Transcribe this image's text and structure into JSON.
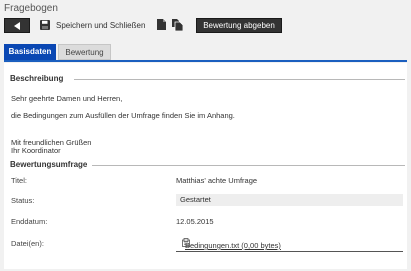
{
  "window": {
    "title": "Fragebogen"
  },
  "toolbar": {
    "back_icon": "arrow-left-icon",
    "save_icon": "floppy-disk-icon",
    "save_label": "Speichern und Schließen",
    "document_icon": "document-icon",
    "documents_icon": "documents-icon",
    "submit_label": "Bewertung abgeben"
  },
  "tabs": [
    {
      "label": "Basisdaten",
      "active": true
    },
    {
      "label": "Bewertung",
      "active": false
    }
  ],
  "description": {
    "legend": "Beschreibung",
    "greeting": "Sehr geehrte Damen und Herren,",
    "body": "die Bedingungen zum Ausfüllen der Umfrage finden Sie im Anhang.",
    "closing": "Mit freundlichen Grüßen",
    "signature": "Ihr Koordinator"
  },
  "survey": {
    "legend": "Bewertungsumfrage",
    "title_label": "Titel:",
    "title_value": "Matthias' achte Umfrage",
    "status_label": "Status:",
    "status_value": "Gestartet",
    "end_date_label": "Enddatum:",
    "end_date_value": "12.05.2015",
    "files_label": "Datei(en):",
    "file_icon": "attachment-file-icon",
    "file_link": "Bedingungen.txt (0,00 bytes)"
  },
  "colors": {
    "active_tab": "#0a47b3",
    "tab_underline": "#1b5fbf",
    "toolbar_button": "#333333"
  }
}
